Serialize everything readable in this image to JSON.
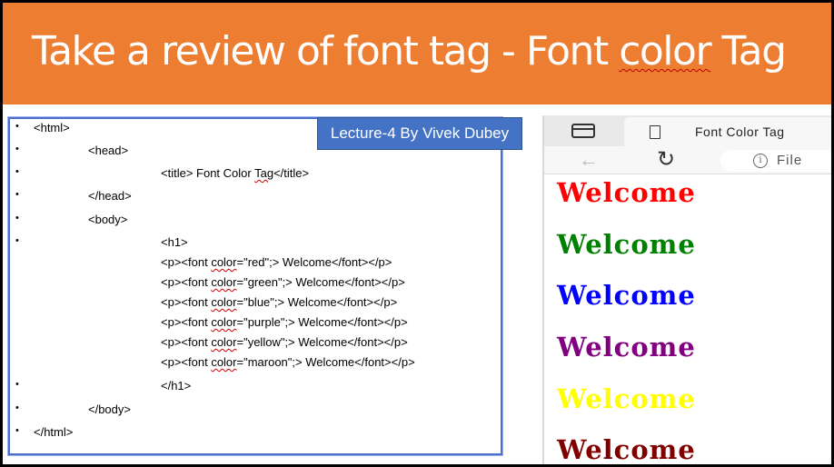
{
  "slide": {
    "title_part1": "Take a review of font tag - Font ",
    "title_part2": "color",
    "title_part3": " Tag"
  },
  "lecture_badge": "Lecture-4 By Vivek Dubey",
  "code": {
    "bullet_glyph": "•",
    "html_open": "<html>",
    "head_open": "<head>",
    "title_a": "<title> Font Color ",
    "title_b": "Tag",
    "title_c": "</title>",
    "head_close": "</head>",
    "body_open": "<body>",
    "h1_open": "<h1>",
    "font_lines": [
      {
        "pre": "<p><font ",
        "attr": "color",
        "post": "=\"red\";> Welcome</font></p>"
      },
      {
        "pre": "<p><font ",
        "attr": "color",
        "post": "=\"green\";> Welcome</font></p>"
      },
      {
        "pre": "<p><font ",
        "attr": "color",
        "post": "=\"blue\";> Welcome</font></p>"
      },
      {
        "pre": "<p><font ",
        "attr": "color",
        "post": "=\"purple\";> Welcome</font></p>"
      },
      {
        "pre": "<p><font ",
        "attr": "color",
        "post": "=\"yellow\";> Welcome</font></p>"
      },
      {
        "pre": "<p><font ",
        "attr": "color",
        "post": "=\"maroon\";> Welcome</font></p>"
      }
    ],
    "h1_close": "</h1>",
    "body_close": "</body>",
    "html_close": "</html>"
  },
  "browser": {
    "tab_title": "Font Color Tag",
    "address_text": "File",
    "info_glyph": "i",
    "back_glyph": "←",
    "reload_glyph": "↻",
    "welcome": [
      {
        "text": "Welcome",
        "color": "#ff0000"
      },
      {
        "text": "Welcome",
        "color": "#008000"
      },
      {
        "text": "Welcome",
        "color": "#0000ff"
      },
      {
        "text": "Welcome",
        "color": "#800080"
      },
      {
        "text": "Welcome",
        "color": "#ffff00"
      },
      {
        "text": "Welcome",
        "color": "#800000"
      }
    ]
  }
}
